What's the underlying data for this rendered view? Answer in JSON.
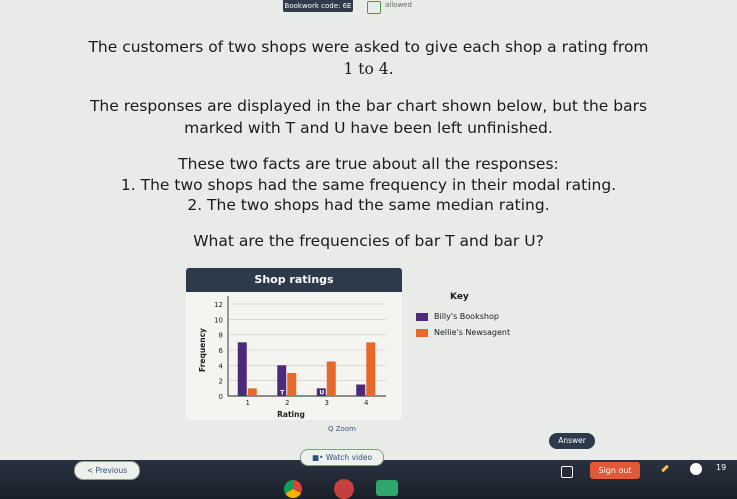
{
  "topbar": {
    "bookwork_code": "Bookwork code: 6E",
    "calculator": "allowed"
  },
  "question": {
    "line1": "The customers of two shops were asked to give each shop a rating from",
    "line2": "1 to 4.",
    "line3": "The responses are displayed in the bar chart shown below, but the bars",
    "line4": "marked with T and U have been left unfinished.",
    "line5": "These two facts are true about all the responses:",
    "line6": "1. The two shops had the same frequency in their modal rating.",
    "line7": "2. The two shops had the same median rating.",
    "line8": "What are the frequencies of bar T and bar U?"
  },
  "chart_header": "Shop ratings",
  "chart_data": {
    "type": "bar",
    "title": "Shop ratings",
    "xlabel": "Rating",
    "ylabel": "Frequency",
    "categories": [
      "1",
      "2",
      "3",
      "4"
    ],
    "yticks": [
      "0",
      "2",
      "4",
      "6",
      "8",
      "10",
      "12"
    ],
    "ylim": [
      0,
      12
    ],
    "series": [
      {
        "name": "Billy's Bookshop",
        "values": [
          7,
          4,
          1,
          1.5
        ],
        "color": "#4b2a78"
      },
      {
        "name": "Nellie's Newsagent",
        "values": [
          1,
          3,
          4.5,
          7
        ],
        "color": "#e56a2a"
      }
    ],
    "bar_labels": {
      "t": "T",
      "u": "U"
    },
    "grid": true
  },
  "key": {
    "title": "Key",
    "items": [
      {
        "label": "Billy's Bookshop",
        "color": "#4b2a78"
      },
      {
        "label": "Nellie's Newsagent",
        "color": "#e56a2a"
      }
    ]
  },
  "controls": {
    "zoom": "Q Zoom",
    "watch_video": "■• Watch video",
    "answer": "Answer",
    "previous": "< Previous",
    "sign_out": "Sign out",
    "clock": "19"
  }
}
